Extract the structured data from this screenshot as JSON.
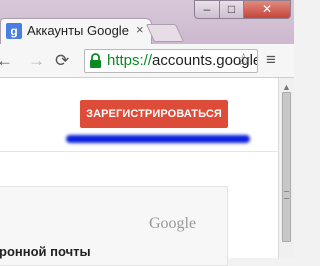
{
  "browser": {
    "tab": {
      "favicon": "g",
      "title": "Аккаунты Google",
      "close_glyph": "×"
    },
    "window_buttons": {
      "minimize": "–",
      "maximize": "□",
      "close": "✕"
    },
    "toolbar": {
      "back_glyph": "←",
      "forward_glyph": "→",
      "reload_glyph": "⟳",
      "url_scheme": "https://",
      "url_host": "accounts.google.com",
      "star_glyph": "☆",
      "menu_glyph": "≡"
    }
  },
  "page": {
    "signup_button": "ЗАРЕГИСТРИРОВАТЬСЯ",
    "card_logo": "Google",
    "card_text": "ронной почты"
  },
  "colors": {
    "signup": "#dd4b39",
    "annotation": "#0a1fdc",
    "secure_url": "#0b8a24"
  }
}
